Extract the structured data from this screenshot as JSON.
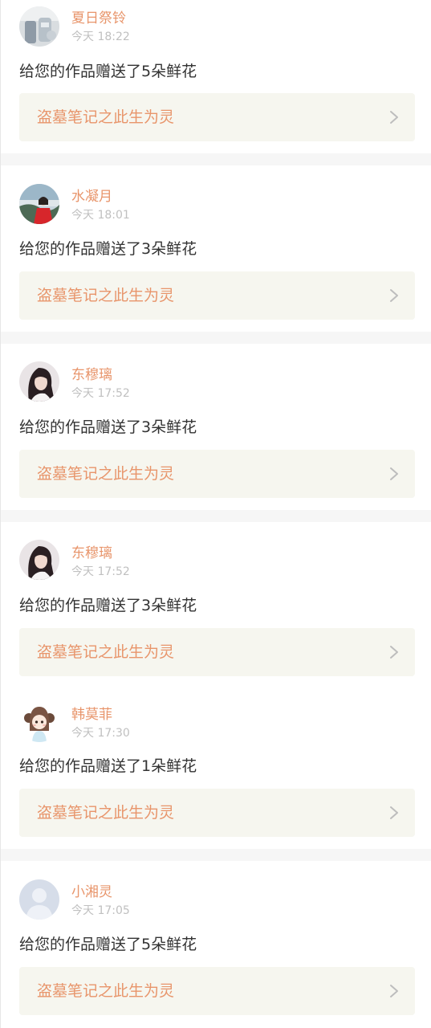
{
  "notifications": [
    {
      "username": "夏日祭铃",
      "time": "今天 18:22",
      "message": "给您的作品赠送了5朵鲜花",
      "work_title": "盗墓笔记之此生为灵",
      "avatar": "photo-avatar-objects"
    },
    {
      "username": "水凝月",
      "time": "今天 18:01",
      "message": "给您的作品赠送了3朵鲜花",
      "work_title": "盗墓笔记之此生为灵",
      "avatar": "photo-avatar-girl-red-dress"
    },
    {
      "username": "东穆璃",
      "time": "今天 17:52",
      "message": "给您的作品赠送了3朵鲜花",
      "work_title": "盗墓笔记之此生为灵",
      "avatar": "photo-avatar-dark-hair-girl"
    },
    {
      "username": "东穆璃",
      "time": "今天 17:52",
      "message": "给您的作品赠送了3朵鲜花",
      "work_title": "盗墓笔记之此生为灵",
      "avatar": "photo-avatar-dark-hair-girl"
    },
    {
      "username": "韩莫菲",
      "time": "今天 17:30",
      "message": "给您的作品赠送了1朵鲜花",
      "work_title": "盗墓笔记之此生为灵",
      "avatar": "cartoon-avatar-girl"
    },
    {
      "username": "小湘灵",
      "time": "今天 17:05",
      "message": "给您的作品赠送了5朵鲜花",
      "work_title": "盗墓笔记之此生为灵",
      "avatar": "default-person-avatar"
    }
  ],
  "colors": {
    "accent": "#e8956b",
    "timestamp": "#c0c0c0",
    "message_text": "#333333",
    "link_background": "#f6f6ef",
    "separator": "#f6f6f6"
  }
}
